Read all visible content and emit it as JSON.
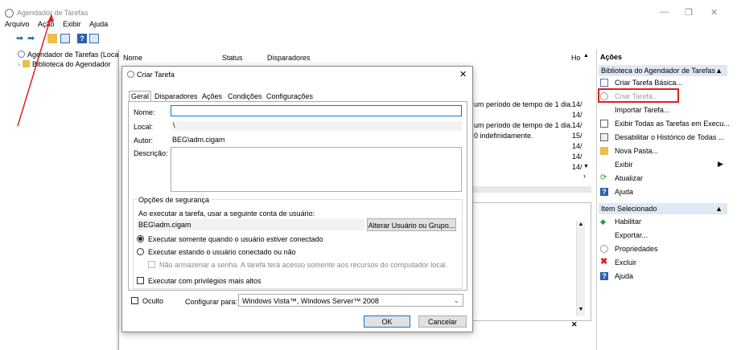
{
  "window": {
    "title": "Agendador de Tarefas",
    "min": "—",
    "max": "❐",
    "close": "✕"
  },
  "menu": [
    "Arquivo",
    "Ação",
    "Exibir",
    "Ajuda"
  ],
  "tree": {
    "root": "Agendador de Tarefas (Local)",
    "child": "Biblioteca do Agendador"
  },
  "table": {
    "columns": [
      "Nome",
      "Status",
      "Disparadores",
      "Ho"
    ],
    "rows": [
      {
        "trigger": "um período de tempo de 1 dia.",
        "date": "14/"
      },
      {
        "trigger": "",
        "date": "14/"
      },
      {
        "trigger": "um período de tempo de 1 dia.",
        "date": "14/"
      },
      {
        "trigger": "0 indefinidamente.",
        "date": "15/"
      },
      {
        "trigger": "",
        "date": "14/"
      },
      {
        "trigger": "",
        "date": "14/"
      },
      {
        "trigger": "",
        "date": "14/"
      }
    ],
    "lower_close": "✕"
  },
  "actions": {
    "title": "Ações",
    "group1": "Biblioteca do Agendador de Tarefas",
    "items1": [
      "Criar Tarefa Básica...",
      "Criar Tarefa...",
      "Importar Tarefa...",
      "Exibir Todas as Tarefas em Execu...",
      "Desabilitar o Histórico de Todas ...",
      "Nova Pasta...",
      "Exibir",
      "Atualizar",
      "Ajuda"
    ],
    "group2": "Item Selecionado",
    "items2": [
      "Habilitar",
      "Exportar...",
      "Propriedades",
      "Excluir",
      "Ajuda"
    ]
  },
  "dialog": {
    "title": "Criar Tarefa",
    "close": "✕",
    "tabs": [
      "Geral",
      "Disparadores",
      "Ações",
      "Condições",
      "Configurações"
    ],
    "name_label": "Nome:",
    "name_value": "",
    "local_label": "Local:",
    "local_value": "\\",
    "author_label": "Autor:",
    "author_value": "BEG\\adm.cigam",
    "desc_label": "Descrição:",
    "security_title": "Opções de segurança",
    "account_prompt": "Ao executar a tarefa, usar a seguinte conta de usuário:",
    "account": "BEG\\adm.cigam",
    "change_user": "Alterar Usuário ou Grupo...",
    "radio1": "Executar somente quando o usuário estiver conectado",
    "radio2": "Executar estando o usuário conectado ou não",
    "no_store": "Não armazenar a senha. A tarefa terá acesso somente aos recursos do computador local.",
    "highest": "Executar com privilégios mais altos",
    "hidden": "Oculto",
    "configure_label": "Configurar para:",
    "configure_value": "Windows Vista™, Windows Server™ 2008",
    "ok": "OK",
    "cancel": "Cancelar"
  }
}
